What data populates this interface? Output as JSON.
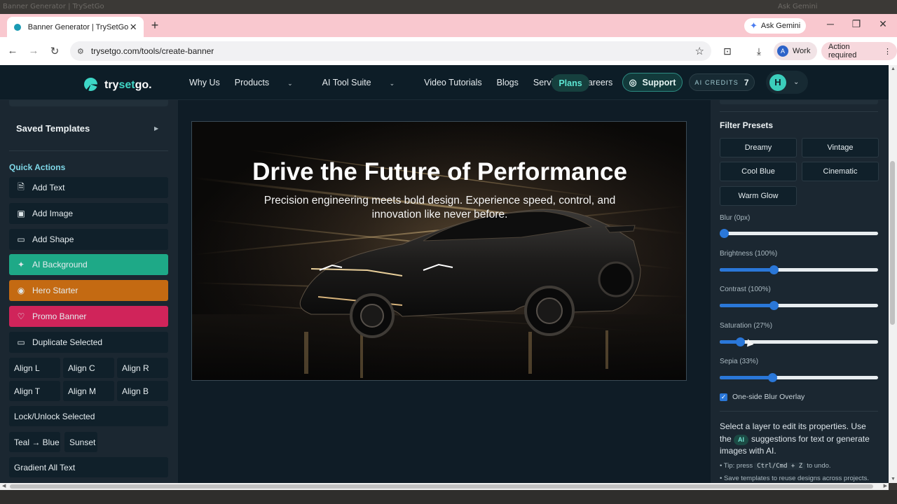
{
  "browser": {
    "ghost_text_left": "Banner Generator | TrySetGo",
    "ghost_text_right": "Ask Gemini",
    "tab_title": "Banner Generator | TrySetGo",
    "new_tab": "+",
    "ask_gemini": "Ask Gemini",
    "url": "trysetgo.com/tools/create-banner",
    "profile_initial": "A",
    "profile_label": "Work",
    "action_required": "Action required"
  },
  "site": {
    "logo_pre": "try",
    "logo_mid": "set",
    "logo_post": "go.",
    "nav": {
      "why_us": "Why Us",
      "products": "Products",
      "ai_tool_suite": "AI Tool Suite",
      "video_tutorials": "Video Tutorials",
      "blogs": "Blogs",
      "services": "Services",
      "careers": "Careers"
    },
    "plans": "Plans",
    "support": "Support",
    "credits_label": "AI CREDITS",
    "credits_value": "7",
    "user_initial": "H"
  },
  "left_panel": {
    "saved_templates": "Saved Templates",
    "quick_actions_title": "Quick Actions",
    "actions": {
      "add_text": "Add Text",
      "add_image": "Add Image",
      "add_shape": "Add Shape",
      "ai_background": "AI Background",
      "hero_starter": "Hero Starter",
      "promo_banner": "Promo Banner",
      "duplicate_selected": "Duplicate Selected"
    },
    "align": {
      "align_l": "Align L",
      "align_c": "Align C",
      "align_r": "Align R",
      "align_t": "Align T",
      "align_m": "Align M",
      "align_b": "Align B"
    },
    "lock_unlock": "Lock/Unlock Selected",
    "teal_blue": "Teal → Blue",
    "sunset": "Sunset",
    "gradient_all_text": "Gradient All Text"
  },
  "banner": {
    "headline": "Drive the Future of Performance",
    "subhead": "Precision engineering meets bold design. Experience speed, control, and innovation like never before."
  },
  "right_panel": {
    "filter_presets_title": "Filter Presets",
    "presets": {
      "dreamy": "Dreamy",
      "vintage": "Vintage",
      "cool_blue": "Cool Blue",
      "cinematic": "Cinematic",
      "warm_glow": "Warm Glow"
    },
    "sliders": {
      "blur": {
        "label": "Blur (0px)",
        "fraction": 0.0
      },
      "brightness": {
        "label": "Brightness (100%)",
        "fraction": 0.34
      },
      "contrast": {
        "label": "Contrast (100%)",
        "fraction": 0.34
      },
      "saturation": {
        "label": "Saturation (27%)",
        "fraction": 0.13
      },
      "sepia": {
        "label": "Sepia (33%)",
        "fraction": 0.33
      }
    },
    "one_side_blur": "One-side Blur Overlay",
    "help_pre": "Select a layer to edit its properties. Use the",
    "ai_chip": "AI",
    "help_post": "suggestions for text or generate images with AI.",
    "tip_pre": "• Tip: press",
    "tip_key": "Ctrl/Cmd + Z",
    "tip_post": "to undo.",
    "tip2": "• Save templates to reuse designs across projects."
  },
  "colors": {
    "nav_bg": "#0d1d27",
    "panel_bg": "#1b2731",
    "accent_teal": "#1ea987",
    "accent_orange": "#c46a12",
    "accent_red": "#d0245a",
    "slider_blue": "#2a77d8"
  }
}
